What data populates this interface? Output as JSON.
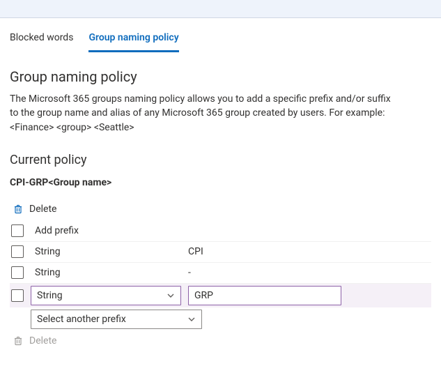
{
  "tabs": {
    "blocked_words": "Blocked words",
    "group_naming": "Group naming policy"
  },
  "heading": "Group naming policy",
  "description": "The Microsoft 365 groups naming policy allows you to add a specific prefix and/or suffix to the group name and alias of any Microsoft 365 group created by users. For example: <Finance> <group> <Seattle>",
  "current_policy_heading": "Current policy",
  "example_policy": "CPI-GRP<Group name>",
  "toolbar": {
    "delete": "Delete"
  },
  "header_row": {
    "label": "Add prefix"
  },
  "rows": [
    {
      "type": "String",
      "value": "CPI"
    },
    {
      "type": "String",
      "value": "-"
    },
    {
      "type": "String",
      "value": "GRP",
      "editing": true
    }
  ],
  "another_prefix_placeholder": "Select another prefix",
  "footer": {
    "delete": "Delete"
  },
  "icons": {
    "trash": "trash-icon",
    "chevron": "chevron-down-icon"
  }
}
